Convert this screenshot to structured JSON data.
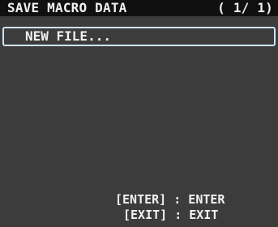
{
  "header": {
    "title": "SAVE MACRO DATA",
    "page_indicator": "( 1/ 1)"
  },
  "list": {
    "items": [
      {
        "label": "NEW FILE...",
        "selected": true
      }
    ]
  },
  "footer": {
    "enter_hint": "[ENTER] : ENTER",
    "exit_hint": "[EXIT] : EXIT"
  },
  "colors": {
    "background": "#3c3c3c",
    "header_background": "#101010",
    "text": "#f2f2f2",
    "selection_border": "#cfe4f4"
  }
}
